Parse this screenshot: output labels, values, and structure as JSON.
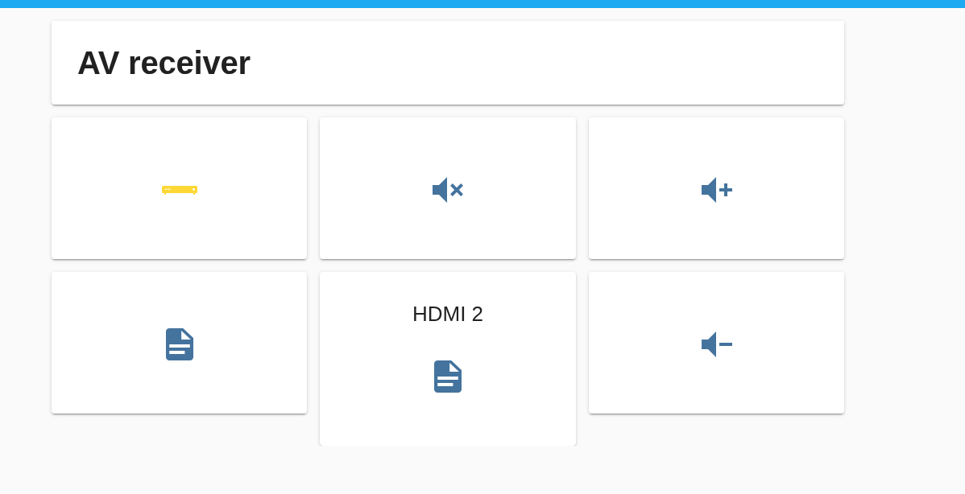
{
  "title": "AV receiver",
  "cards": [
    {
      "kind": "set-top-box",
      "on": true
    },
    {
      "kind": "mute",
      "on": false
    },
    {
      "kind": "volume-up",
      "on": false
    },
    {
      "kind": "document",
      "on": false
    },
    {
      "kind": "document",
      "name": "HDMI 2",
      "on": false
    },
    {
      "kind": "volume-down",
      "on": false
    }
  ]
}
